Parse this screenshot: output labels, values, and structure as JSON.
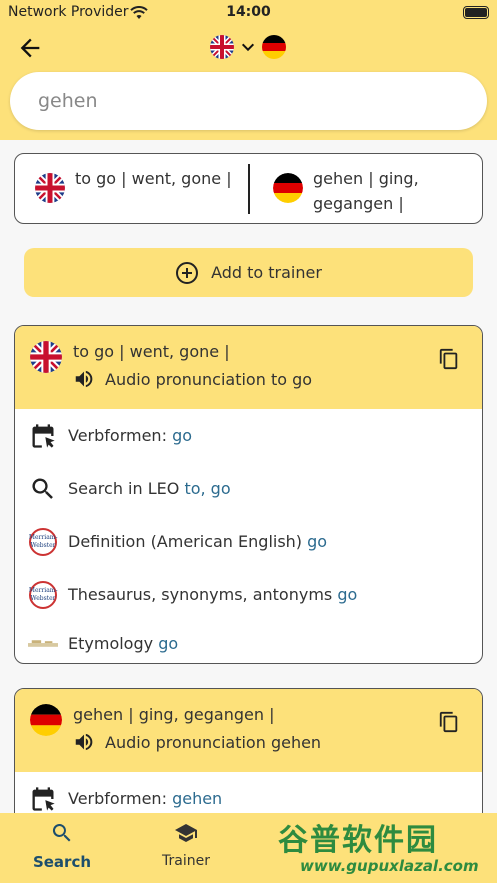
{
  "status_bar": {
    "carrier": "Network Provider",
    "time": "14:00"
  },
  "header": {
    "source_lang": "English",
    "target_lang": "German",
    "search_value": "gehen"
  },
  "translation_box": {
    "left_text": "to go  | went, gone |",
    "right_text": "gehen  | ging, gegangen |"
  },
  "add_button": {
    "label": "Add to trainer"
  },
  "card_en": {
    "term": "to go  | went, gone |",
    "audio_label": "Audio pronunciation to go",
    "rows": [
      {
        "label": "Verbformen:",
        "link": "go",
        "icon": "calendar-cursor-icon"
      },
      {
        "label": "Search in LEO",
        "link": "to, go",
        "icon": "search-icon"
      },
      {
        "label": "Definition (American English)",
        "link": "go",
        "icon": "merriam-webster-icon"
      },
      {
        "label": "Thesaurus, synonyms, antonyms",
        "link": "go",
        "icon": "merriam-webster-icon"
      },
      {
        "label": "Etymology",
        "link": "go",
        "icon": "etymology-icon"
      }
    ]
  },
  "card_de": {
    "term": "gehen  | ging, gegangen |",
    "audio_label": "Audio pronunciation gehen",
    "rows": [
      {
        "label": "Verbformen:",
        "link": "gehen",
        "icon": "calendar-cursor-icon"
      }
    ]
  },
  "mw_logo_text": "Merriam-Webster",
  "bottom_nav": {
    "items": [
      {
        "label": "Search",
        "icon": "search-icon",
        "active": true
      },
      {
        "label": "Trainer",
        "icon": "graduation-cap-icon",
        "active": false
      }
    ]
  },
  "watermark": {
    "title": "谷普软件园",
    "url": "www.gupuxlazal.com"
  },
  "colors": {
    "accent_yellow": "#fde17a",
    "link_blue": "#2c6b8f",
    "text": "#333333"
  }
}
